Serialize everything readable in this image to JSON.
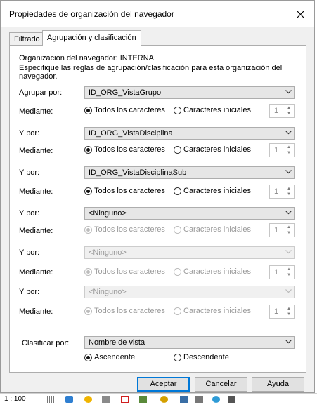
{
  "dialog": {
    "title": "Propiedades de organización del navegador",
    "close_glyph": "✕"
  },
  "tabs": [
    {
      "label": "Filtrado",
      "active": false
    },
    {
      "label": "Agrupación y clasificación",
      "active": true
    }
  ],
  "panel": {
    "org_line": "Organización del navegador: INTERNA",
    "instructions_line1": "Especifique las reglas de agrupación/clasificación para esta organización del",
    "instructions_line2": "navegador.",
    "rules": [
      {
        "label": "Agrupar por:",
        "value": "ID_ORG_VistaGrupo",
        "enabled": true
      },
      {
        "label": "Y por:",
        "value": "ID_ORG_VistaDisciplina",
        "enabled": true
      },
      {
        "label": "Y por:",
        "value": "ID_ORG_VistaDisciplinaSub",
        "enabled": true
      },
      {
        "label": "Y por:",
        "value": "<Ninguno>",
        "enabled": true
      },
      {
        "label": "Y por:",
        "value": "<Ninguno>",
        "enabled": false
      },
      {
        "label": "Y por:",
        "value": "<Ninguno>",
        "enabled": false
      }
    ],
    "mediante": {
      "label": "Mediante:",
      "option_all": "Todos los caracteres",
      "option_initial": "Caracteres iniciales",
      "spin_value": "1",
      "enabled": [
        true,
        true,
        true,
        false,
        false,
        false
      ]
    },
    "sort": {
      "label": "Clasificar por:",
      "value": "Nombre de vista",
      "ascending": "Ascendente",
      "descending": "Descendente",
      "selected": "Ascendente"
    }
  },
  "buttons": {
    "ok": "Aceptar",
    "cancel": "Cancelar",
    "help": "Ayuda"
  },
  "statusbar": {
    "scale": "1 : 100"
  }
}
